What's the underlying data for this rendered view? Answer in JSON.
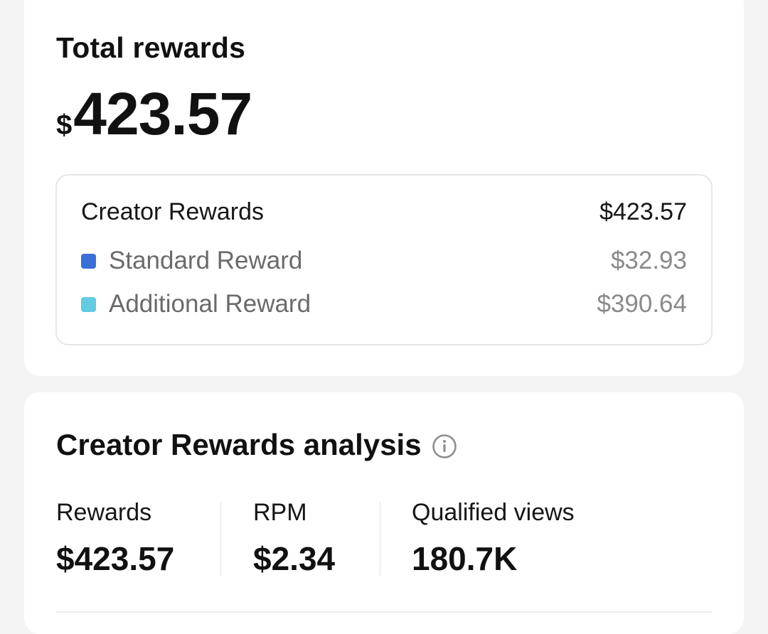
{
  "total_rewards": {
    "title": "Total rewards",
    "currency_symbol": "$",
    "amount": "423.57"
  },
  "breakdown": {
    "header_label": "Creator Rewards",
    "header_value": "$423.57",
    "items": [
      {
        "label": "Standard Reward",
        "value": "$32.93",
        "color": "#3a6fd8"
      },
      {
        "label": "Additional Reward",
        "value": "$390.64",
        "color": "#62cbe0"
      }
    ]
  },
  "analysis": {
    "title": "Creator Rewards analysis",
    "info_icon": "info-icon",
    "metrics": [
      {
        "label": "Rewards",
        "value": "$423.57"
      },
      {
        "label": "RPM",
        "value": "$2.34"
      },
      {
        "label": "Qualified views",
        "value": "180.7K"
      }
    ]
  }
}
